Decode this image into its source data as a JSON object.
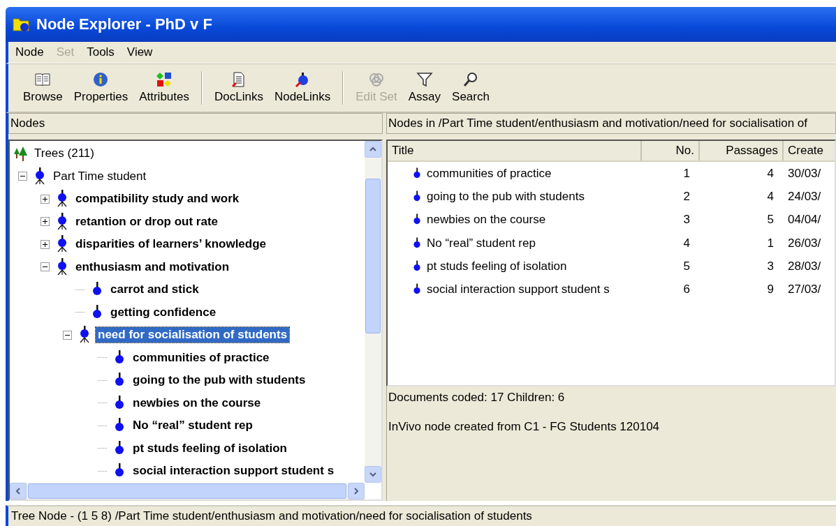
{
  "window": {
    "title": "Node Explorer - PhD v F"
  },
  "menu": [
    {
      "label": "Node",
      "disabled": false
    },
    {
      "label": "Set",
      "disabled": true
    },
    {
      "label": "Tools",
      "disabled": false
    },
    {
      "label": "View",
      "disabled": false
    }
  ],
  "toolbar": [
    {
      "kind": "browse",
      "label": "Browse",
      "disabled": false,
      "group_end": false
    },
    {
      "kind": "properties",
      "label": "Properties",
      "disabled": false,
      "group_end": false
    },
    {
      "kind": "attributes",
      "label": "Attributes",
      "disabled": false,
      "group_end": true
    },
    {
      "kind": "doclinks",
      "label": "DocLinks",
      "disabled": false,
      "group_end": false
    },
    {
      "kind": "nodelinks",
      "label": "NodeLinks",
      "disabled": false,
      "group_end": true
    },
    {
      "kind": "editset",
      "label": "Edit Set",
      "disabled": true,
      "group_end": false
    },
    {
      "kind": "assay",
      "label": "Assay",
      "disabled": false,
      "group_end": false
    },
    {
      "kind": "search",
      "label": "Search",
      "disabled": false,
      "group_end": false
    }
  ],
  "nodes_pane": {
    "header": "Nodes",
    "root": "Trees (211)",
    "items": [
      {
        "kind": "branch",
        "label": "Part Time student",
        "coded": false,
        "expanded": true,
        "selected": false,
        "children": [
          {
            "kind": "branch",
            "label": "compatibility study and work",
            "coded": true,
            "expanded": false,
            "selected": false
          },
          {
            "kind": "branch",
            "label": "retantion or drop out rate",
            "coded": true,
            "expanded": false,
            "selected": false
          },
          {
            "kind": "branch",
            "label": "disparities of learners’ knowledge",
            "coded": true,
            "expanded": false,
            "selected": false
          },
          {
            "kind": "branch",
            "label": "enthusiasm and motivation",
            "coded": true,
            "expanded": true,
            "selected": false,
            "children": [
              {
                "kind": "leaf",
                "label": "carrot and stick",
                "coded": true,
                "selected": false
              },
              {
                "kind": "leaf",
                "label": "getting confidence",
                "coded": true,
                "selected": false
              },
              {
                "kind": "branch",
                "label": "need for socialisation of students",
                "coded": true,
                "expanded": true,
                "selected": true,
                "children": [
                  {
                    "kind": "leaf",
                    "label": "communities of practice",
                    "coded": true,
                    "selected": false
                  },
                  {
                    "kind": "leaf",
                    "label": "going to the pub with students",
                    "coded": true,
                    "selected": false
                  },
                  {
                    "kind": "leaf",
                    "label": "newbies on the course",
                    "coded": true,
                    "selected": false
                  },
                  {
                    "kind": "leaf",
                    "label": "No “real” student rep",
                    "coded": true,
                    "selected": false
                  },
                  {
                    "kind": "leaf",
                    "label": "pt studs feeling of isolation",
                    "coded": true,
                    "selected": false
                  },
                  {
                    "kind": "leaf",
                    "label": "social interaction support student s",
                    "coded": true,
                    "selected": false
                  }
                ]
              }
            ]
          }
        ]
      }
    ]
  },
  "list_pane": {
    "header": "Nodes in /Part Time student/enthusiasm and motivation/need for socialisation of",
    "columns": [
      "Title",
      "No.",
      "Passages",
      "Create"
    ],
    "rows": [
      [
        "communities of practice",
        "1",
        "4",
        "30/03/"
      ],
      [
        "going to the pub with students",
        "2",
        "4",
        "24/03/"
      ],
      [
        "newbies on the course",
        "3",
        "5",
        "04/04/"
      ],
      [
        "No “real” student rep",
        "4",
        "1",
        "26/03/"
      ],
      [
        "pt studs feeling of isolation",
        "5",
        "3",
        "28/03/"
      ],
      [
        "social interaction support student s",
        "6",
        "9",
        "27/03/"
      ]
    ],
    "summary": "Documents coded: 17 Children: 6",
    "description": "InVivo node created from C1 - FG Students 120104"
  },
  "status_bar": "Tree Node - (1 5 8) /Part Time student/enthusiasm and motivation/need for socialisation of students"
}
